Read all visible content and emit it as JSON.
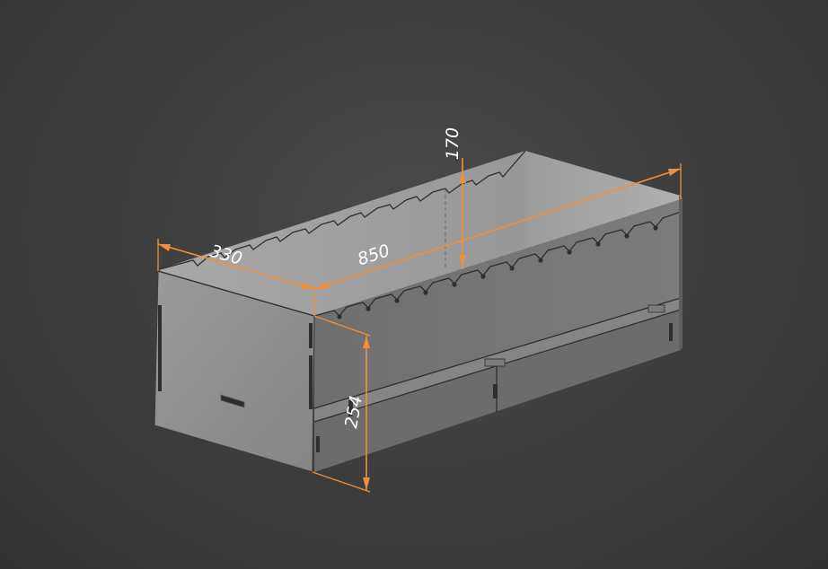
{
  "model": {
    "colors": {
      "background": "#3c3c3c",
      "face_front": "#8f8f8f",
      "face_side": "#7a7a7a",
      "face_inner": "#a3a3a3",
      "dimension": "#f0903a",
      "dimension_text": "#ffffff"
    }
  },
  "dimensions": {
    "width": "330",
    "length": "850",
    "height": "254",
    "wall_height": "170"
  }
}
